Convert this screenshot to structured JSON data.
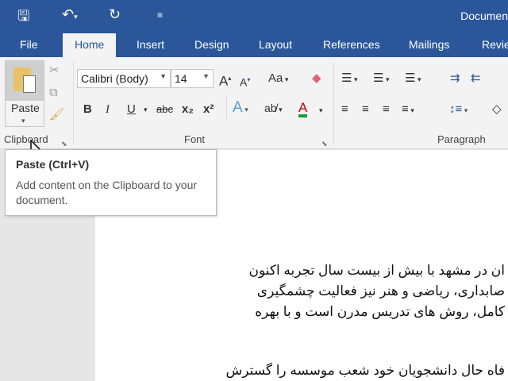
{
  "titlebar": {
    "document_title": "Documen",
    "icons": [
      "save-icon",
      "undo-icon",
      "redo-icon",
      "customize-qat-icon"
    ]
  },
  "tabs": [
    "File",
    "Home",
    "Insert",
    "Design",
    "Layout",
    "References",
    "Mailings",
    "Revie"
  ],
  "active_tab": "Home",
  "ribbon": {
    "clipboard": {
      "label": "Clipboard",
      "paste_label": "Paste"
    },
    "font": {
      "label": "Font",
      "font_name": "Calibri (Body)",
      "font_size": "14",
      "change_case": "Aa",
      "bold": "B",
      "italic": "I",
      "underline": "U",
      "strike": "abc",
      "subscript": "x₂",
      "superscript": "x²",
      "font_color": "#1a9a3a"
    },
    "paragraph": {
      "label": "Paragraph"
    }
  },
  "tooltip": {
    "title": "Paste (Ctrl+V)",
    "body": "Add content on the Clipboard to your document."
  },
  "document": {
    "lines": [
      "ان در مشهد با بیش از بیست سال تجربه اکنون",
      "صابداری، ریاضی و هنر نیز فعالیت چشمگیری",
      "کامل، روش های تدریس مدرن است و با بهره",
      "فاه حال دانشجویان خود شعب موسسه را گسترش"
    ]
  },
  "colors": {
    "brand": "#2b579a",
    "ribbon": "#f3f3f3",
    "workspace": "#e6e6e6"
  }
}
